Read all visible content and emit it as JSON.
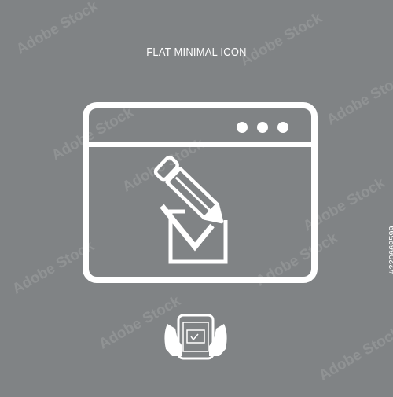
{
  "caption": "FLAT MINIMAL ICON",
  "watermark_text": "Adobe Stock",
  "stock_id": "#220669599",
  "colors": {
    "background": "#808385",
    "foreground": "#ffffff"
  },
  "icons": {
    "main": "browser-window-checkbox-pencil-icon",
    "thumbnail": "hands-holding-tablet-icon"
  }
}
